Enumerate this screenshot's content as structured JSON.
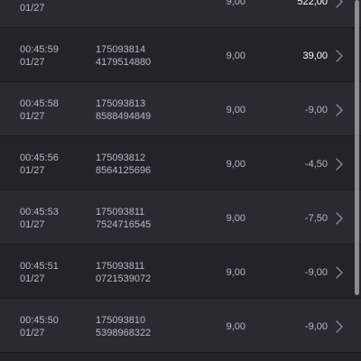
{
  "colors": {
    "background": "#24232b",
    "row_alt": "#2b2a33",
    "text": "#b9b8c2",
    "positive_amount": "#ffffff",
    "loading_icon": "#e0a800"
  },
  "rows": [
    {
      "time": "",
      "date": "01/27",
      "id_line1": "",
      "id_line2": "",
      "stake": "9,00",
      "amount": "522,00",
      "loading": true,
      "positive": true
    },
    {
      "time": "00:45:59",
      "date": "01/27",
      "id_line1": "175093814",
      "id_line2": "4179514880",
      "stake": "9,00",
      "amount": "39,00",
      "loading": false,
      "positive": true
    },
    {
      "time": "00:45:58",
      "date": "01/27",
      "id_line1": "175093813",
      "id_line2": "8588494849",
      "stake": "9,00",
      "amount": "-9,00",
      "loading": false,
      "positive": false
    },
    {
      "time": "00:45:56",
      "date": "01/27",
      "id_line1": "175093812",
      "id_line2": "8564125696",
      "stake": "9,00",
      "amount": "-4,50",
      "loading": false,
      "positive": false
    },
    {
      "time": "00:45:53",
      "date": "01/27",
      "id_line1": "175093811",
      "id_line2": "7524716545",
      "stake": "9,00",
      "amount": "-7,50",
      "loading": false,
      "positive": false
    },
    {
      "time": "00:45:51",
      "date": "01/27",
      "id_line1": "175093811",
      "id_line2": "0721539072",
      "stake": "9,00",
      "amount": "-9,00",
      "loading": false,
      "positive": false
    },
    {
      "time": "00:45:50",
      "date": "01/27",
      "id_line1": "175093810",
      "id_line2": "5398968322",
      "stake": "9,00",
      "amount": "-9,00",
      "loading": false,
      "positive": false
    }
  ]
}
